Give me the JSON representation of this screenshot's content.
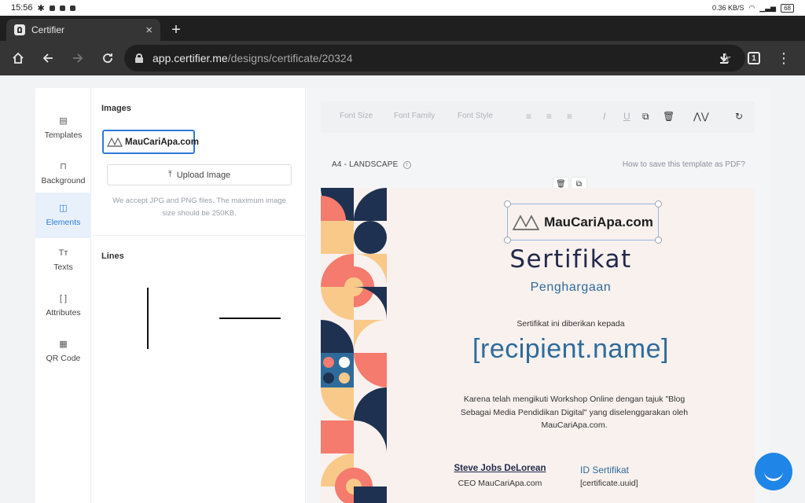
{
  "statusbar": {
    "time": "15:56",
    "net_speed": "0.36 KB/S",
    "battery": "68"
  },
  "browser": {
    "tab_title": "Certifier",
    "tab_close": "×",
    "new_tab": "+",
    "url_domain": "app.certifier.me",
    "url_path": "/designs/certificate/20324",
    "tab_count": "1"
  },
  "nav": {
    "items": [
      {
        "label": "Templates",
        "icon": "document-icon",
        "glyph": "▤"
      },
      {
        "label": "Background",
        "icon": "paint-roller-icon",
        "glyph": "⊓"
      },
      {
        "label": "Elements",
        "icon": "shapes-icon",
        "glyph": "◫"
      },
      {
        "label": "Texts",
        "icon": "text-icon",
        "glyph": "Tт"
      },
      {
        "label": "Attributes",
        "icon": "brackets-icon",
        "glyph": "[ ]"
      },
      {
        "label": "QR Code",
        "icon": "qr-code-icon",
        "glyph": "▦"
      }
    ],
    "active": "Elements"
  },
  "panel": {
    "images_title": "Images",
    "image_logo_text": "MauCariApa.com",
    "upload_label": "Upload Image",
    "help_text": "We accept JPG and PNG files. The maximum image size should be 250KB.",
    "lines_title": "Lines"
  },
  "editor": {
    "toolbar": {
      "font_size": "Font Size",
      "font_family": "Font Family",
      "font_style": "Font Style"
    },
    "page_size": "A4 - LANDSCAPE",
    "pdf_help": "How to save this template as PDF?"
  },
  "certificate": {
    "logo_text": "MauCariApa.com",
    "title": "Sertifikat",
    "subtitle": "Penghargaan",
    "given_to": "Sertifikat ini diberikan kepada",
    "recipient": "[recipient.name]",
    "body": "Karena telah mengikuti Workshop Online dengan tajuk \"Blog Sebagai Media Pendidikan Digital\" yang diselenggarakan oleh MauCariApa.com.",
    "signer_name": "Steve Jobs DeLorean",
    "signer_role": "CEO MauCariApa.com",
    "id_label": "ID Sertifikat",
    "id_value": "[certificate.uuid]"
  },
  "colors": {
    "accent": "#2d7ad6",
    "navy": "#1f3150",
    "coral": "#f47b6d",
    "peach": "#f9c98a",
    "teal": "#2f6b9a",
    "cream": "#f8f1ee",
    "fab": "#1f86e8"
  }
}
